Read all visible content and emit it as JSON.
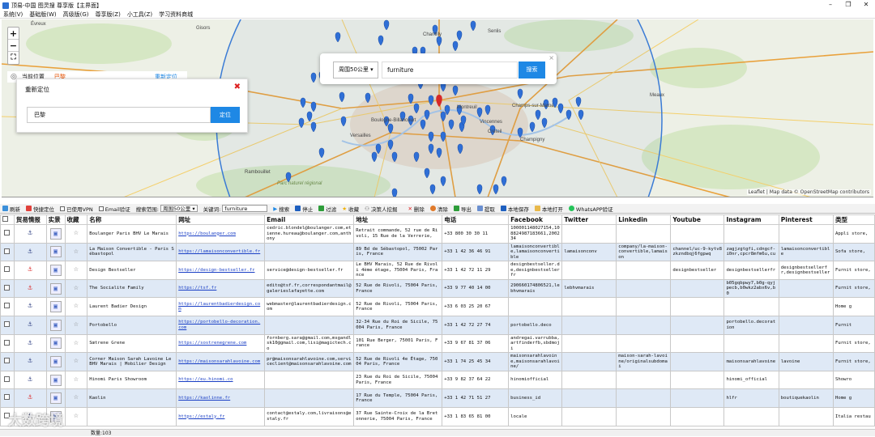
{
  "window": {
    "title": "顶易-中国 图灵搜 尊享版【主界面】",
    "min": "–",
    "max": "❐",
    "close": "✕"
  },
  "menu": [
    "系统(V)",
    "基础版(W)",
    "高级版(G)",
    "尊享版(Z)",
    "小工具(Z)",
    "学习资料商城"
  ],
  "map": {
    "zoom_in": "+",
    "zoom_out": "−",
    "fullscreen": "⛶",
    "current_location_label": "当前位置",
    "current_location_value": "巴黎",
    "relocate_link": "重新定位",
    "attribution": "Leaflet | Map data © OpenStreetMap contributors",
    "place_labels": [
      "Évreux",
      "Gisors",
      "Chantilly",
      "Senlis",
      "Meaux",
      "Montreuil",
      "Boulogne-Billancourt",
      "Versailles",
      "Vincennes",
      "Créteil",
      "Parc naturel régional",
      "Champs-sur-Marne",
      "Rambouillet",
      "Champigny"
    ]
  },
  "relocate_panel": {
    "title": "重新定位",
    "close": "✖",
    "input_value": "巴黎",
    "button": "定位"
  },
  "search_panel": {
    "radius_select": "周围50公里 ▾",
    "keyword": "furniture",
    "button": "搜索",
    "close": "×"
  },
  "toolbar": {
    "refresh": "刷新",
    "quick_locate": "快捷定位",
    "vpn": "已使用VPN",
    "email_verify": "Email验证",
    "range_label": "搜索范围:",
    "range_value": "周围50公里 ▾",
    "keyword_label": "关键词:",
    "keyword_value": "furniture",
    "search": "搜索",
    "stop": "停止",
    "filter": "过滤",
    "favorites": "收藏",
    "decision_maker": "决策人挖掘",
    "delete": "删除",
    "clear": "清除",
    "export": "导出",
    "extract": "提取",
    "save_local": "本地保存",
    "open_local": "本地打开",
    "whatsapp_verify": "WhatsAPP验证"
  },
  "table": {
    "headers": [
      "",
      "贸易情报",
      "实景",
      "收藏",
      "名称",
      "网址",
      "Email",
      "地址",
      "电话",
      "Facebook",
      "Twitter",
      "Linkedin",
      "Youtube",
      "Instagram",
      "Pinterest",
      "类型"
    ],
    "rows": [
      {
        "red": false,
        "name": "Boulanger Paris BHV Le Marais",
        "url": "https://boulanger.com",
        "email": "cedric.blondel@boulanger.com,etienne.hureau@boulanger.com,anthony",
        "address": "Retrait commande, 52 rue de Rivoli, 15 Rue de la Verrerie,",
        "phone": "+33 800 30 30 11",
        "facebook": "100001148027154,108824987183661,200234",
        "twitter": "",
        "linkedin": "",
        "youtube": "",
        "instagram": "",
        "pinterest": "",
        "type": "Appli store,"
      },
      {
        "red": false,
        "name": "La Maison Convertible - Paris Sébastopol",
        "url": "https://lamaisonconvertible.fr",
        "email": "",
        "address": "89 Bd de Sébastopol, 75002 Paris, France",
        "phone": "+33 1 42 36 46 91",
        "facebook": "lamaisonconvertible,lamaisonconvertible",
        "twitter": "lamaisonconv",
        "linkedin": "company/la-maison-convertible,lamaison",
        "youtube": "channel/uc-9-kytv8zkzndbqj6fgpwq",
        "instagram": "zagjzgtgfi,cdngcf-i0nr,cpcr8mfm6u,cu",
        "pinterest": "lamaisonconvertible",
        "type": "Sofa store,"
      },
      {
        "red": true,
        "name": "Design Bestseller",
        "url": "https://design-bestseller.fr",
        "email": "service@design-bestseller.fr",
        "address": "Le BHV Marais, 52 Rue de Rivoli 4ème étage, 75004 Paris, France",
        "phone": "+33 1 42 72 11 29",
        "facebook": "designbestseller.de,designbestsellerfr",
        "twitter": "",
        "linkedin": "",
        "youtube": "designbestseller",
        "instagram": "designbestsellerfr",
        "pinterest": "designbestsellerfr,designbestseller",
        "type": "Furnit store,"
      },
      {
        "red": true,
        "name": "The Socialite Family",
        "url": "https://tsf.fr",
        "email": "edito@tsf.fr,correspondantmail@galerieslafayette.com",
        "address": "52 Rue de Rivoli, 75004 Paris, France",
        "phone": "+33 9 77 40 14 00",
        "facebook": "290660174806521,lebhvmarais",
        "twitter": "lebhvmarais",
        "linkedin": "",
        "youtube": "",
        "instagram": "b05gqbpwy7,b0g-qyjpecb,b0wkz2abx6v,b0",
        "pinterest": "",
        "type": "Furnit store,"
      },
      {
        "red": false,
        "name": "Laurent Badier Design",
        "url": "https://laurentbadierdesign.com",
        "email": "webmaster@laurentbadierdesign.com",
        "address": "52 Rue de Rivoli, 75004 Paris, France",
        "phone": "+33 6 03 25 20 67",
        "facebook": "",
        "twitter": "",
        "linkedin": "",
        "youtube": "",
        "instagram": "",
        "pinterest": "",
        "type": "Home g"
      },
      {
        "red": false,
        "name": "Portobello",
        "url": "https://portobello-decoration.com",
        "email": "",
        "address": "32-34 Rue du Roi de Sicile, 75004 Paris, France",
        "phone": "+33 1 42 72 27 74",
        "facebook": "portobello.deco",
        "twitter": "",
        "linkedin": "",
        "youtube": "",
        "instagram": "portobello.decoration",
        "pinterest": "",
        "type": "Furnit"
      },
      {
        "red": false,
        "name": "Sœtrene Grene",
        "url": "https://sostrenegrene.com",
        "email": "fornberg.sara@gmail.com,msgandlsk10@gmail.com,lisi@magictech.co",
        "address": "101 Rue Berger, 75001 Paris, France",
        "phone": "+33 9 67 81 37 06",
        "facebook": "andregai.varrubba,artfinderfb,sbdmoji",
        "twitter": "",
        "linkedin": "",
        "youtube": "",
        "instagram": "",
        "pinterest": "",
        "type": "Furnit store,"
      },
      {
        "red": false,
        "name": "Corner Maison Sarah Lavoine Le BHV Marais | Mobilier Design",
        "url": "https://maisonsarahlavoine.com",
        "email": "pr@maisonsarahlavoine.com,serviceclient@maisonsarahlavoine.com",
        "address": "52 Rue de Rivoli 4e Étage, 75004 Paris, France",
        "phone": "+33 1 74 25 45 34",
        "facebook": "maisonsarahlavoine,maisonsarahlavoine/",
        "twitter": "",
        "linkedin": "maison-sarah-lavoine/originalsubdomai",
        "youtube": "",
        "instagram": "maisonsarahlavoine",
        "pinterest": "lavoine",
        "type": "Furnit store,"
      },
      {
        "red": false,
        "name": "Hinomi Paris Showroom",
        "url": "https://eu.hinomi.co",
        "email": "",
        "address": "23 Rue du Roi de Sicile, 75004 Paris, France",
        "phone": "+33 9 82 37 64 22",
        "facebook": "hinomiofficial",
        "twitter": "",
        "linkedin": "",
        "youtube": "",
        "instagram": "hinomi_official",
        "pinterest": "",
        "type": "Showro"
      },
      {
        "red": true,
        "name": "Kaolin",
        "url": "https://kaolinne.fr",
        "email": "",
        "address": "17 Rue du Temple, 75004 Paris, France",
        "phone": "+33 1 42 71 51 27",
        "facebook": "business_id",
        "twitter": "",
        "linkedin": "",
        "youtube": "",
        "instagram": "hlfr",
        "pinterest": "boutiquekaolin",
        "type": "Home g"
      },
      {
        "red": false,
        "name": "",
        "url": "https://estaly.fr",
        "email": "contact@estaly.com,livraisons@estaly.fr",
        "address": "37 Rue Sainte-Croix de la Bretonnerie, 75004 Paris, France",
        "phone": "+33 1 83 65 81 00",
        "facebook": "locale",
        "twitter": "",
        "linkedin": "",
        "youtube": "",
        "instagram": "",
        "pinterest": "",
        "type": "Italia restau"
      }
    ]
  },
  "status": {
    "count": "数量:103"
  },
  "watermark": "大数跨境",
  "colors": {
    "accent": "#1e88e5",
    "row_alt": "#dfe9f6",
    "marker": "#2f6fd6",
    "marker_center": "#d62828",
    "radius_circle": "#3a7bd5"
  }
}
